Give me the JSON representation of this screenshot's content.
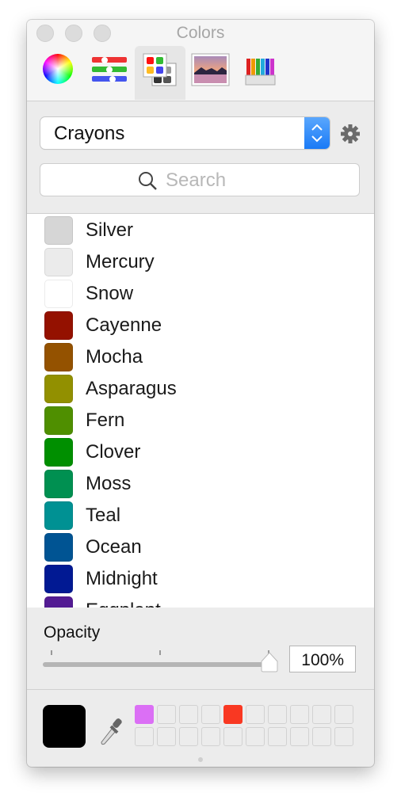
{
  "window": {
    "title": "Colors"
  },
  "toolbar": {
    "tabs": [
      {
        "name": "color-wheel",
        "selected": false
      },
      {
        "name": "color-sliders",
        "selected": false
      },
      {
        "name": "color-palettes",
        "selected": true
      },
      {
        "name": "image-palettes",
        "selected": false
      },
      {
        "name": "pencils",
        "selected": false
      }
    ]
  },
  "palette": {
    "selected": "Crayons"
  },
  "search": {
    "placeholder": "Search"
  },
  "colors": [
    {
      "name": "Silver",
      "color": "#d6d6d6"
    },
    {
      "name": "Mercury",
      "color": "#ebebeb"
    },
    {
      "name": "Snow",
      "color": "#ffffff"
    },
    {
      "name": "Cayenne",
      "color": "#941100"
    },
    {
      "name": "Mocha",
      "color": "#945200"
    },
    {
      "name": "Asparagus",
      "color": "#929000"
    },
    {
      "name": "Fern",
      "color": "#4f8f00"
    },
    {
      "name": "Clover",
      "color": "#008f00"
    },
    {
      "name": "Moss",
      "color": "#009051"
    },
    {
      "name": "Teal",
      "color": "#009193"
    },
    {
      "name": "Ocean",
      "color": "#005493"
    },
    {
      "name": "Midnight",
      "color": "#011993"
    },
    {
      "name": "Eggplant",
      "color": "#531b93"
    }
  ],
  "opacity": {
    "label": "Opacity",
    "value_percent": 100,
    "value_text": "100%"
  },
  "current_color": "#000000",
  "swatches": [
    "#db6ff5",
    "",
    "",
    "",
    "#f93822",
    "",
    "",
    "",
    "",
    "",
    "",
    "",
    "",
    "",
    "",
    "",
    "",
    "",
    "",
    ""
  ]
}
